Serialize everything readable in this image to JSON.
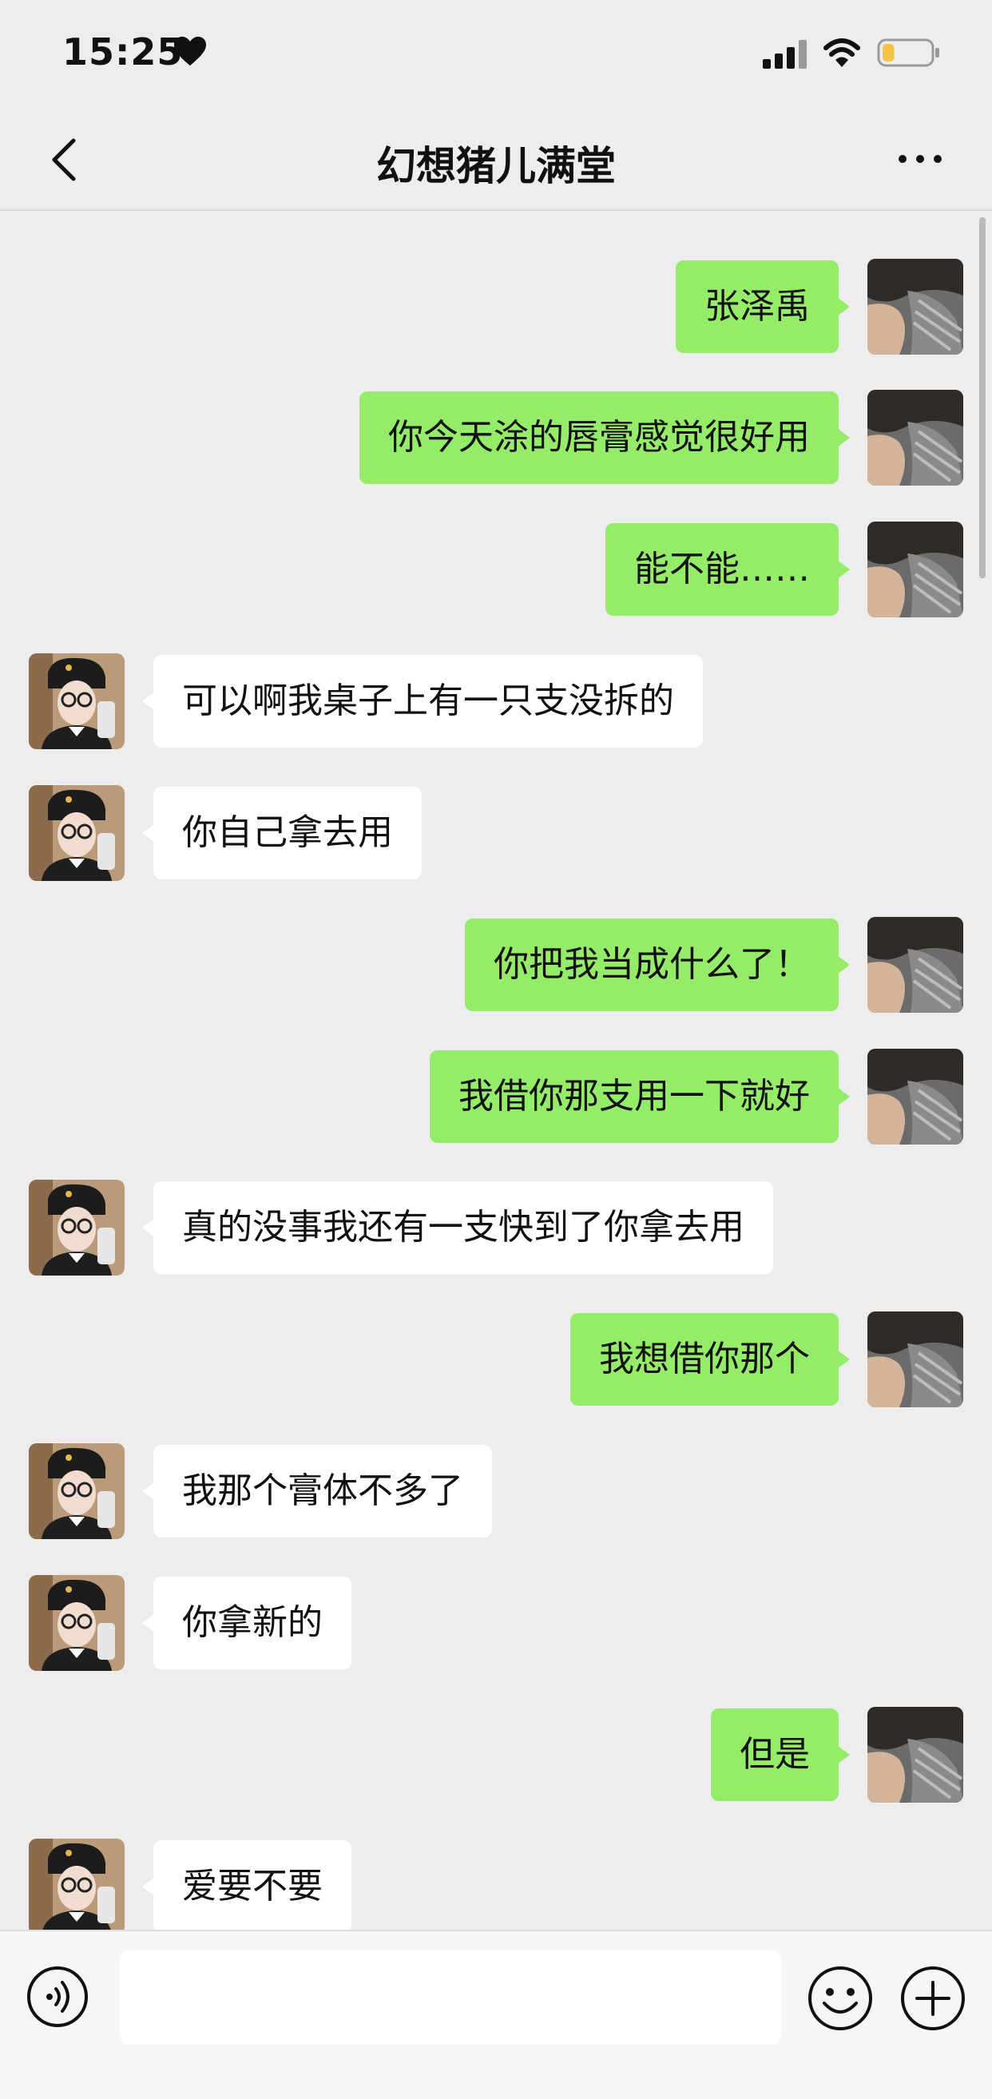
{
  "status_bar": {
    "time": "15:25"
  },
  "header": {
    "title": "幻想猪儿满堂"
  },
  "messages": [
    {
      "side": "me",
      "text": "张泽禹"
    },
    {
      "side": "me",
      "text": "你今天涂的唇膏感觉很好用"
    },
    {
      "side": "me",
      "text": "能不能……"
    },
    {
      "side": "other",
      "text": "可以啊我桌子上有一只支没拆的"
    },
    {
      "side": "other",
      "text": "你自己拿去用"
    },
    {
      "side": "me",
      "text": "你把我当成什么了！"
    },
    {
      "side": "me",
      "text": "我借你那支用一下就好"
    },
    {
      "side": "other",
      "text": "真的没事我还有一支快到了你拿去用"
    },
    {
      "side": "me",
      "text": "我想借你那个"
    },
    {
      "side": "other",
      "text": "我那个膏体不多了"
    },
    {
      "side": "other",
      "text": "你拿新的"
    },
    {
      "side": "me",
      "text": "但是"
    },
    {
      "side": "other",
      "text": "爱要不要"
    }
  ],
  "input": {
    "value": "",
    "placeholder": ""
  },
  "icons": {
    "back": "chevron-left-icon",
    "more": "more-dots-icon",
    "voice": "voice-icon",
    "emoji": "emoji-icon",
    "plus": "plus-icon"
  },
  "colors": {
    "background": "#ededed",
    "my_bubble": "#95ec69",
    "other_bubble": "#ffffff",
    "battery_level": "#f6c343"
  },
  "battery_level": 0.25
}
